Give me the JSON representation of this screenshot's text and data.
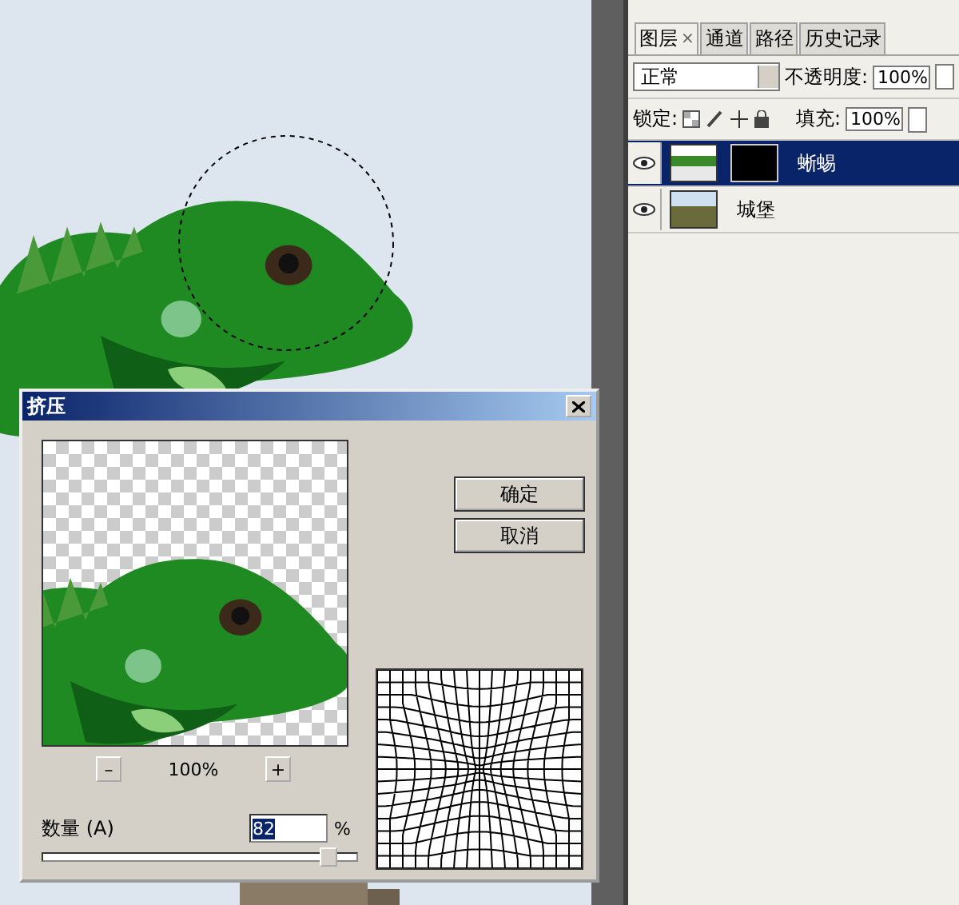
{
  "layers_panel": {
    "tabs": [
      {
        "label": "图层",
        "selected": true,
        "close": "×"
      },
      {
        "label": "通道",
        "selected": false
      },
      {
        "label": "路径",
        "selected": false
      },
      {
        "label": "历史记录",
        "selected": false
      }
    ],
    "blend_mode": "正常",
    "opacity_label": "不透明度:",
    "opacity": "100%",
    "lock_label": "锁定:",
    "fill_label": "填充:",
    "fill": "100%",
    "layers": [
      {
        "name": "蜥蜴",
        "selected": true,
        "visible": true,
        "has_mask": true,
        "kind": "iguana"
      },
      {
        "name": "城堡",
        "selected": false,
        "visible": true,
        "has_mask": false,
        "kind": "castle"
      }
    ]
  },
  "dialog": {
    "title": "挤压",
    "buttons": [
      "确定",
      "取消"
    ],
    "zoom_out": "–",
    "zoom": "100%",
    "zoom_in": "+",
    "amount_label": "数量 (A)",
    "amount": "82",
    "unit": "%",
    "slider": {
      "level": 0.91
    }
  }
}
